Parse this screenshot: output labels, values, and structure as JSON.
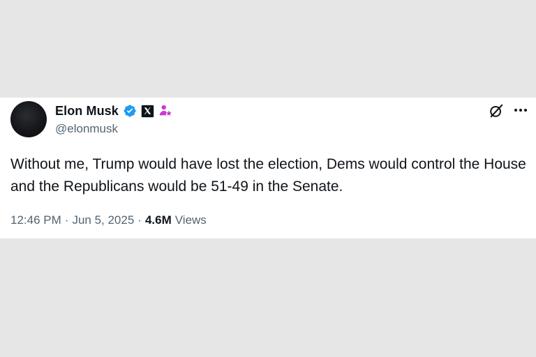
{
  "tweet": {
    "author": {
      "display_name": "Elon Musk",
      "handle": "@elonmusk",
      "avatar_icon": "avatar-dark-circle",
      "badges": [
        "verified-badge-icon",
        "x-affiliation-icon",
        "agent-figure-icon"
      ]
    },
    "text": "Without me, Trump would have lost the election, Dems would control the House and the Republicans would be 51-49 in the Senate.",
    "time": "12:46 PM",
    "separator": "·",
    "date": "Jun 5, 2025",
    "views_count": "4.6M",
    "views_label": "Views",
    "actions": [
      "grok-icon",
      "more-options-icon"
    ]
  },
  "colors": {
    "background": "#e6e6e6",
    "card": "#ffffff",
    "text_primary": "#0f1419",
    "text_secondary": "#536471",
    "verified_blue": "#1d9bf0",
    "agent_magenta": "#c63bd0"
  }
}
